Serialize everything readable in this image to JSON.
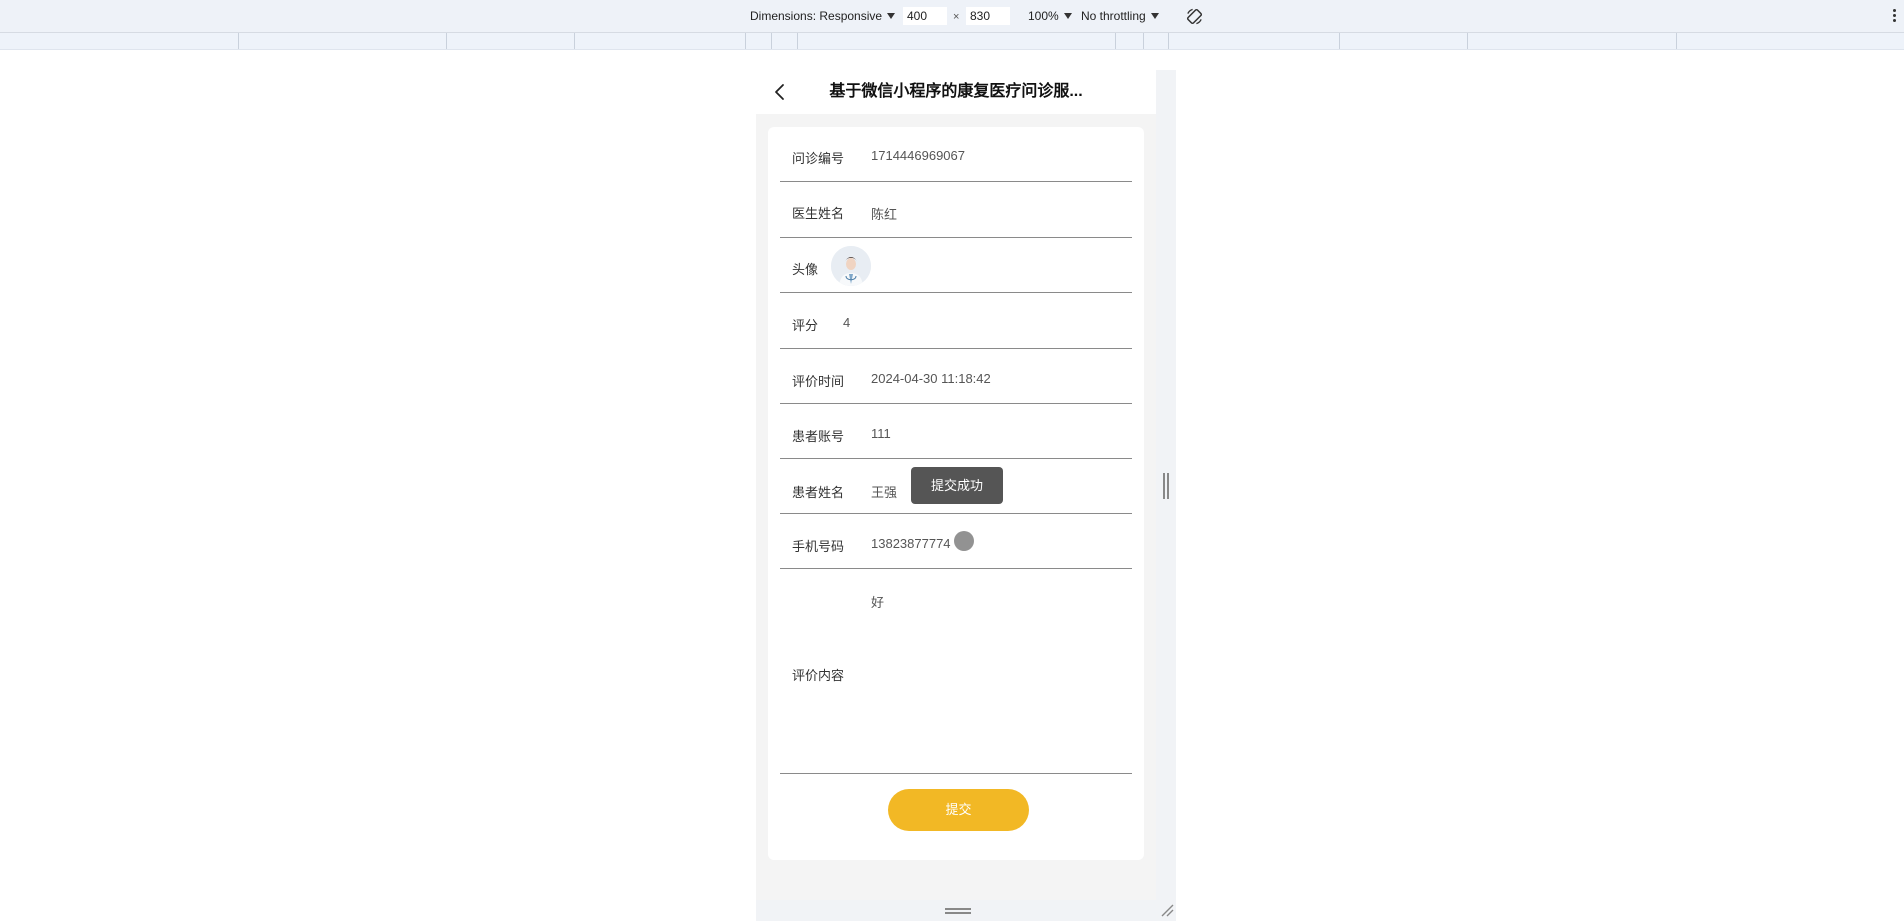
{
  "devtools": {
    "dimensions_label": "Dimensions: Responsive",
    "width_value": "400",
    "times": "×",
    "height_value": "830",
    "zoom": "100%",
    "throttle": "No throttling"
  },
  "page": {
    "title": "基于微信小程序的康复医疗问诊服..."
  },
  "form": {
    "inquiry_no_label": "问诊编号",
    "inquiry_no_value": "1714446969067",
    "doctor_name_label": "医生姓名",
    "doctor_name_value": "陈红",
    "avatar_label": "头像",
    "score_label": "评分",
    "score_value": "4",
    "review_time_label": "评价时间",
    "review_time_value": "2024-04-30 11:18:42",
    "patient_account_label": "患者账号",
    "patient_account_value": "111",
    "patient_name_label": "患者姓名",
    "patient_name_value": "王强",
    "phone_label": "手机号码",
    "phone_value": "13823877774",
    "review_content_label": "评价内容",
    "review_content_value": "好",
    "submit_label": "提交"
  },
  "toast": {
    "text": "提交成功"
  },
  "colors": {
    "accent": "#f2b825",
    "toast_bg": "#555555",
    "divider": "#8a8a8a"
  }
}
